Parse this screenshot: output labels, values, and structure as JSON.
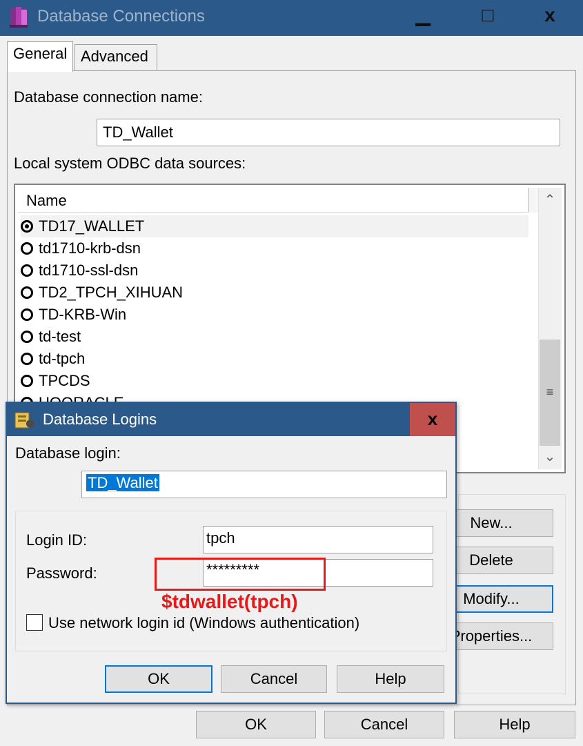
{
  "window": {
    "title": "Database Connections",
    "minimize_glyph": "▁",
    "maximize_glyph": "□",
    "close_glyph": "x"
  },
  "tabs": [
    {
      "label": "General"
    },
    {
      "label": "Advanced"
    }
  ],
  "general": {
    "connection_name_label": "Database connection name:",
    "connection_name_value": "TD_Wallet",
    "odbc_label": "Local system ODBC data sources:",
    "list_header": "Name",
    "data_sources": [
      {
        "name": "TD17_WALLET",
        "selected": true
      },
      {
        "name": "td1710-krb-dsn",
        "selected": false
      },
      {
        "name": "td1710-ssl-dsn",
        "selected": false
      },
      {
        "name": "TD2_TPCH_XIHUAN",
        "selected": false
      },
      {
        "name": "TD-KRB-Win",
        "selected": false
      },
      {
        "name": "td-test",
        "selected": false
      },
      {
        "name": "td-tpch",
        "selected": false
      },
      {
        "name": "TPCDS",
        "selected": false
      },
      {
        "name": "UOORACLE",
        "selected": false
      }
    ],
    "side_buttons": {
      "new": "New...",
      "delete": "Delete",
      "modify": "Modify...",
      "properties": "Properties..."
    }
  },
  "footer": {
    "ok": "OK",
    "cancel": "Cancel",
    "help": "Help"
  },
  "login_dialog": {
    "title": "Database Logins",
    "close_glyph": "x",
    "db_login_label": "Database login:",
    "db_login_value": "TD_Wallet",
    "login_id_label": "Login ID:",
    "login_id_value": "tpch",
    "password_label": "Password:",
    "password_value": "*********",
    "use_network_label": "Use network login id (Windows authentication)",
    "use_network_checked": false,
    "annotation": "$tdwallet(tpch)",
    "ok": "OK",
    "cancel": "Cancel",
    "help": "Help"
  },
  "colors": {
    "title_bar": "#2b5a8a",
    "dialog_close": "#c0504d",
    "annotation_red": "#e31b1b",
    "selection_blue": "#0078d7"
  }
}
